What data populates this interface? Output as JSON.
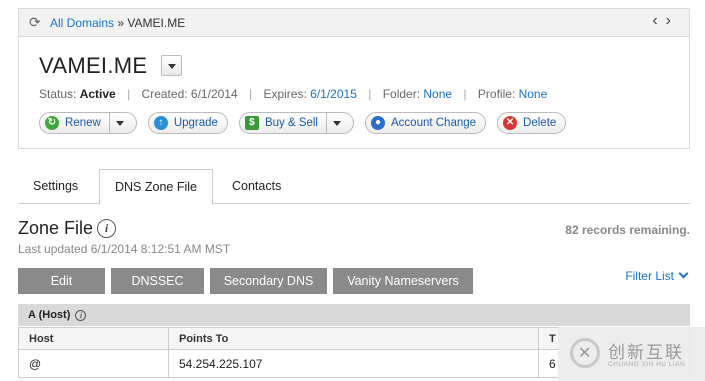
{
  "breadcrumb": {
    "link": "All Domains",
    "separator": "»",
    "current": "VAMEI.ME"
  },
  "domain": {
    "name": "VAMEI.ME",
    "status_label": "Status:",
    "status_value": "Active",
    "created_label": "Created:",
    "created_value": "6/1/2014",
    "expires_label": "Expires:",
    "expires_value": "6/1/2015",
    "folder_label": "Folder:",
    "folder_value": "None",
    "profile_label": "Profile:",
    "profile_value": "None"
  },
  "actions": {
    "renew": "Renew",
    "upgrade": "Upgrade",
    "buy_sell": "Buy & Sell",
    "account_change": "Account Change",
    "delete": "Delete"
  },
  "tabs": [
    "Settings",
    "DNS Zone File",
    "Contacts"
  ],
  "zone": {
    "title": "Zone File",
    "last_updated": "Last updated 6/1/2014 8:12:51 AM MST",
    "remaining": "82 records remaining."
  },
  "toolbar": {
    "edit": "Edit",
    "dnssec": "DNSSEC",
    "secondary_dns": "Secondary DNS",
    "vanity": "Vanity Nameservers",
    "filter": "Filter List"
  },
  "records": {
    "section": "A (Host)",
    "columns": [
      "Host",
      "Points To",
      "T"
    ],
    "rows": [
      {
        "host": "@",
        "points_to": "54.254.225.107",
        "ttl": "6"
      }
    ]
  },
  "watermark": {
    "cn": "创新互联",
    "en": "CHUANG XIN HU LIAN"
  },
  "colors": {
    "link": "#1a73c8",
    "toolbar_button": "#8a8a8a"
  }
}
